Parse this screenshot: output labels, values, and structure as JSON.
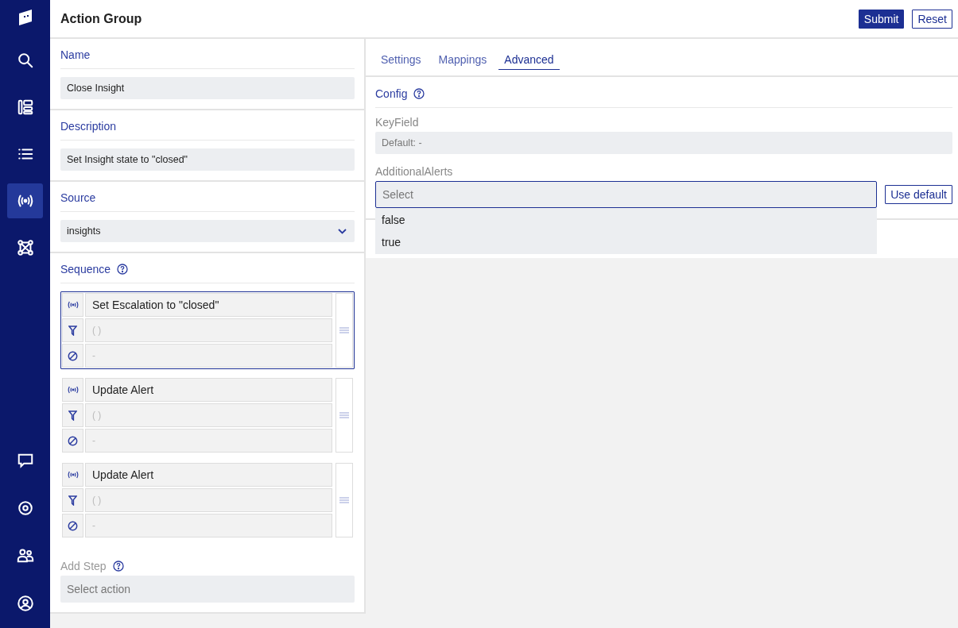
{
  "nav": {
    "top": [
      {
        "kind": "search",
        "selected": false
      },
      {
        "kind": "dashboard",
        "selected": false
      },
      {
        "kind": "list",
        "selected": false
      },
      {
        "kind": "broadcast",
        "selected": true
      },
      {
        "kind": "network",
        "selected": false
      }
    ],
    "bottom": [
      {
        "kind": "chat",
        "selected": false
      },
      {
        "kind": "settings",
        "selected": false
      },
      {
        "kind": "users",
        "selected": false
      },
      {
        "kind": "account",
        "selected": false
      }
    ]
  },
  "header": {
    "title": "Action Group",
    "buttons": [
      {
        "label": "Submit",
        "kind": "primary"
      },
      {
        "label": "Reset",
        "kind": "secondary"
      }
    ]
  },
  "form": {
    "fields": [
      {
        "kind": "text",
        "label": "Name",
        "value": "Close Insight"
      },
      {
        "kind": "text",
        "label": "Description",
        "value": "Set Insight state to \"closed\""
      },
      {
        "kind": "select",
        "label": "Source",
        "value": "insights"
      }
    ],
    "sequence": {
      "label": "Sequence",
      "steps": [
        {
          "selected": true,
          "action": "Set Escalation to \"closed\"",
          "filter": "( )",
          "exclude": "-"
        },
        {
          "selected": false,
          "action": "Update Alert",
          "filter": "( )",
          "exclude": "-"
        },
        {
          "selected": false,
          "action": "Update Alert",
          "filter": "( )",
          "exclude": "-"
        }
      ]
    },
    "add_step": {
      "label": "Add Step",
      "placeholder": "Select action"
    }
  },
  "tabs": [
    {
      "label": "Settings",
      "selected": false
    },
    {
      "label": "Mappings",
      "selected": false
    },
    {
      "label": "Advanced",
      "selected": true
    }
  ],
  "config": {
    "title": "Config",
    "fields": [
      {
        "kind": "text",
        "label": "KeyField",
        "placeholder": "Default:  -"
      },
      {
        "kind": "select",
        "label": "AdditionalAlerts",
        "placeholder": "Select",
        "expanded": true,
        "options": [
          "false",
          "true"
        ],
        "button": "Use default"
      }
    ]
  }
}
